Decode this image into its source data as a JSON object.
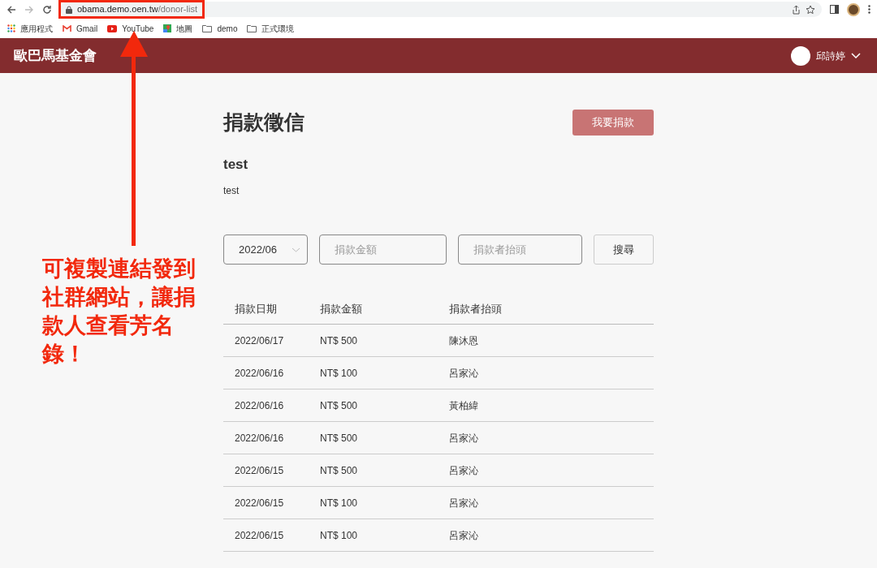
{
  "browser": {
    "url_host": "obama.demo.oen.tw",
    "url_path": "/donor-list",
    "bookmarks": [
      {
        "kind": "apps",
        "label": "應用程式"
      },
      {
        "kind": "gmail",
        "label": "Gmail"
      },
      {
        "kind": "youtube",
        "label": "YouTube"
      },
      {
        "kind": "maps",
        "label": "地圖"
      },
      {
        "kind": "folder",
        "label": "demo"
      },
      {
        "kind": "folder",
        "label": "正式環境"
      }
    ]
  },
  "header": {
    "site_title": "歐巴馬基金會",
    "user_name": "邱詩婷"
  },
  "page": {
    "title": "捐款徵信",
    "donate_button": "我要捐款",
    "campaign_title": "test",
    "campaign_text": "test"
  },
  "filters": {
    "month": "2022/06",
    "amount_placeholder": "捐款金額",
    "name_placeholder": "捐款者抬頭",
    "search_button": "搜尋"
  },
  "table": {
    "columns": [
      "捐款日期",
      "捐款金額",
      "捐款者抬頭"
    ],
    "rows": [
      [
        "2022/06/17",
        "NT$ 500",
        "陳沐恩"
      ],
      [
        "2022/06/16",
        "NT$ 100",
        "呂家沁"
      ],
      [
        "2022/06/16",
        "NT$ 500",
        "黃柏緯"
      ],
      [
        "2022/06/16",
        "NT$ 500",
        "呂家沁"
      ],
      [
        "2022/06/15",
        "NT$ 500",
        "呂家沁"
      ],
      [
        "2022/06/15",
        "NT$ 100",
        "呂家沁"
      ],
      [
        "2022/06/15",
        "NT$ 100",
        "呂家沁"
      ]
    ]
  },
  "annotation": {
    "text": "可複製連結發到社群網站，讓捐款人查看芳名錄！"
  }
}
